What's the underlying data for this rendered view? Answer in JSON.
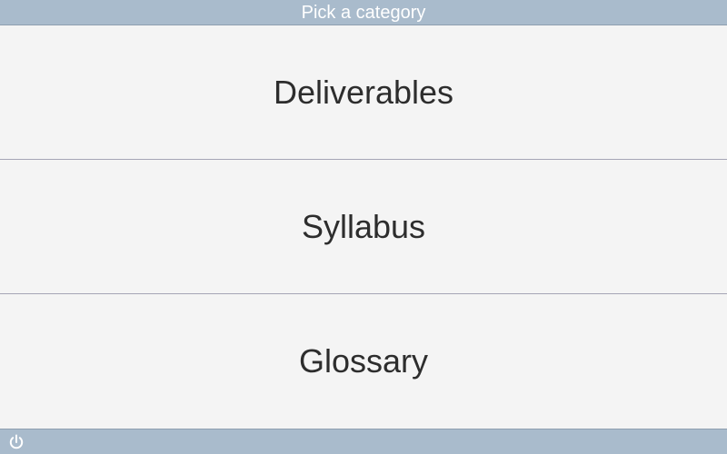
{
  "header": {
    "title": "Pick a category"
  },
  "categories": [
    {
      "label": "Deliverables"
    },
    {
      "label": "Syllabus"
    },
    {
      "label": "Glossary"
    }
  ],
  "footer": {
    "power_icon": "power-icon"
  },
  "colors": {
    "bar": "#a9bbcc",
    "background": "#f4f4f4",
    "divider": "#a5a5b5",
    "text": "#2d2d2d"
  }
}
